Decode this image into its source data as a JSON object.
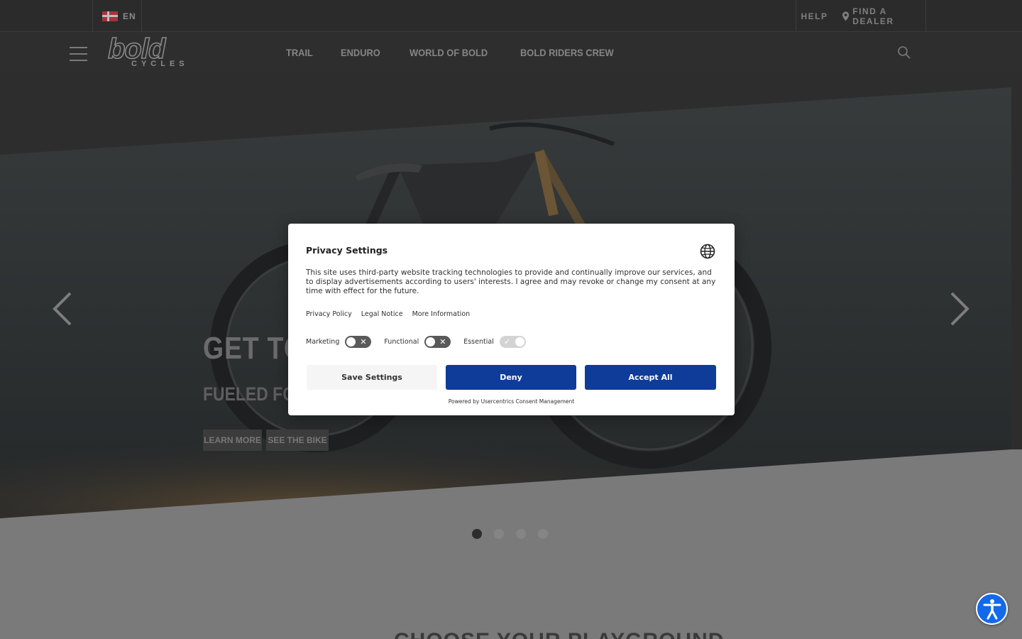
{
  "topbar": {
    "language": "EN",
    "help": "HELP",
    "find_dealer": "FIND A DEALER"
  },
  "brand": {
    "logo_word": "bold",
    "logo_sub": "CYCLES"
  },
  "nav": {
    "links": [
      "TRAIL",
      "ENDURO",
      "WORLD OF BOLD",
      "BOLD RIDERS CREW"
    ]
  },
  "hero": {
    "title": "GET TO",
    "subtitle": "FUELED FOR",
    "learn_more": "LEARN MORE",
    "see_bike": "SEE THE BIKE",
    "slides_total": 4,
    "active_slide": 1
  },
  "section": {
    "heading": "CHOOSE YOUR PLAYGROUND"
  },
  "modal": {
    "title": "Privacy Settings",
    "body": "This site uses third-party website tracking technologies to provide and continually improve our services, and to display advertisements according to users' interests. I agree and may revoke or change my consent at any time with effect for the future.",
    "links": [
      "Privacy Policy",
      "Legal Notice",
      "More Information"
    ],
    "toggles": [
      {
        "label": "Marketing",
        "on": false
      },
      {
        "label": "Functional",
        "on": false
      },
      {
        "label": "Essential",
        "on": true
      }
    ],
    "save_label": "Save Settings",
    "deny_label": "Deny",
    "accept_label": "Accept All",
    "powered_by": "Powered by Usercentrics Consent Management"
  },
  "colors": {
    "primary_button": "#0f3b99",
    "accessibility_button": "#1369e8"
  },
  "icons": [
    "flag-icon",
    "location-pin-icon",
    "hamburger-menu-icon",
    "search-icon",
    "chevron-left-icon",
    "chevron-right-icon",
    "globe-icon",
    "accessibility-icon"
  ]
}
